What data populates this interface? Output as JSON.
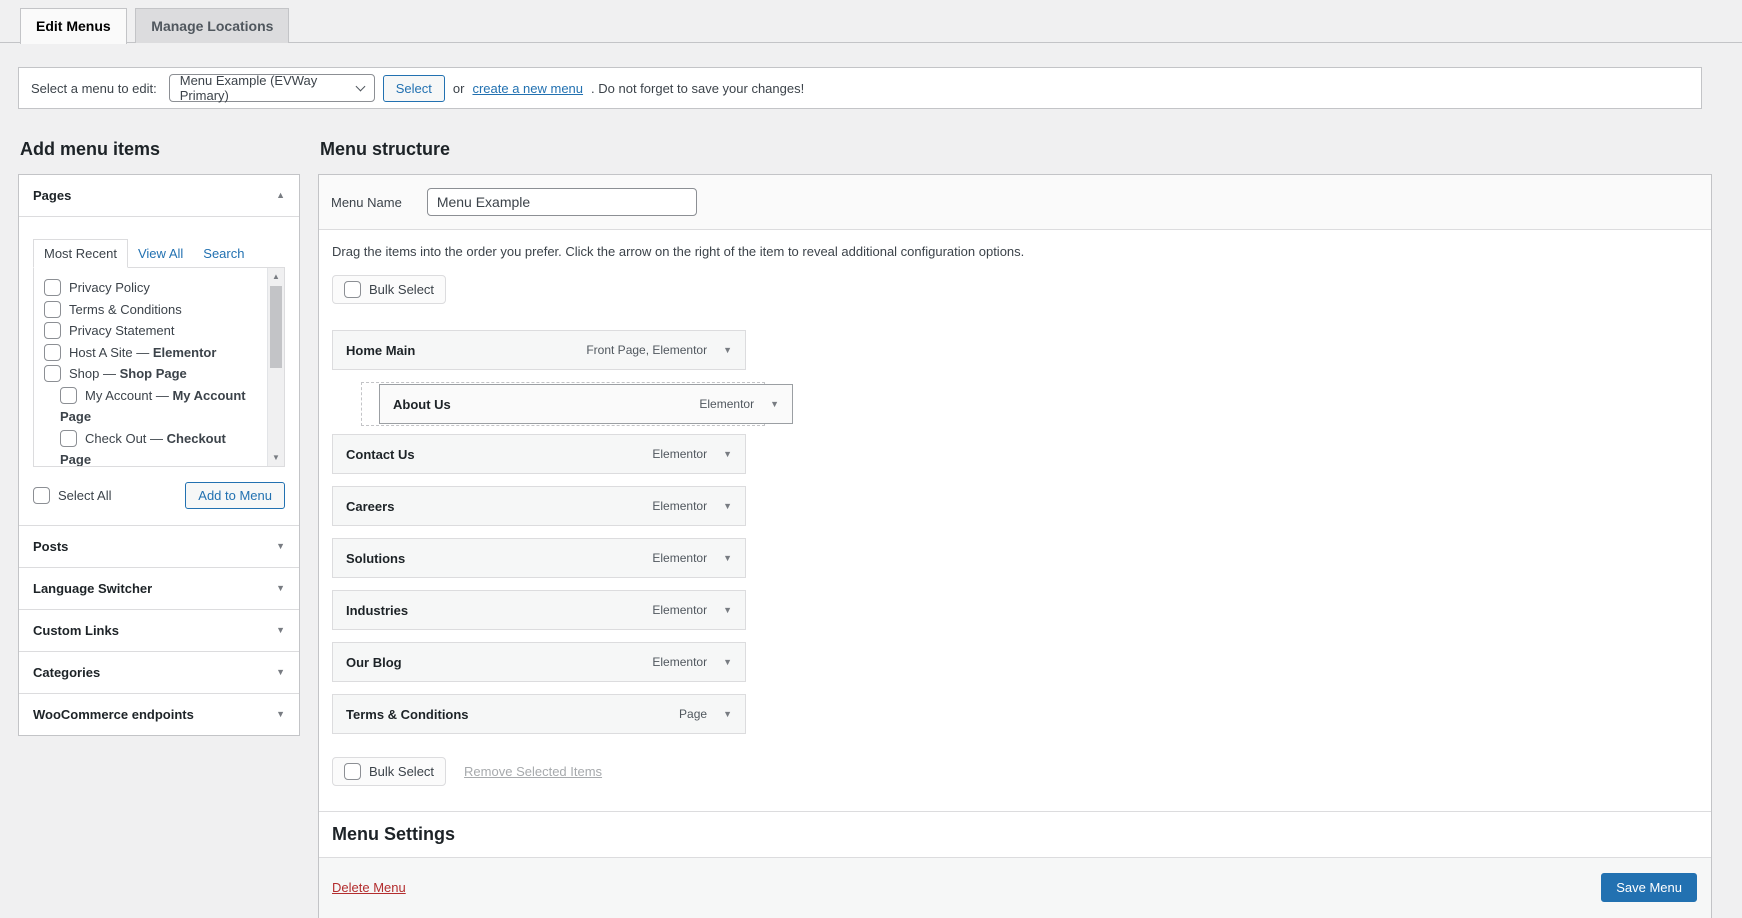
{
  "colors": {
    "accent": "#2271b1",
    "danger": "#b32d2e",
    "background": "#f0f0f1",
    "item_bg": "#f6f7f7"
  },
  "tabs": [
    {
      "label": "Edit Menus",
      "active": true
    },
    {
      "label": "Manage Locations",
      "active": false
    }
  ],
  "menu_select_bar": {
    "label": "Select a menu to edit:",
    "dropdown_value": "Menu Example (EVWay Primary)",
    "select_button": "Select",
    "or_text": "or",
    "create_link": "create a new menu",
    "after_text": ". Do not forget to save your changes!"
  },
  "add_menu_items": {
    "title": "Add menu items",
    "pages_panel": {
      "title": "Pages",
      "tabs": [
        "Most Recent",
        "View All",
        "Search"
      ],
      "active_tab": "Most Recent",
      "items": [
        {
          "label": "Privacy Policy",
          "suffix": "",
          "indent": false
        },
        {
          "label": "Terms & Conditions",
          "suffix": "",
          "indent": false
        },
        {
          "label": "Privacy Statement",
          "suffix": "",
          "indent": false
        },
        {
          "label": "Host A Site",
          "suffix": "Elementor",
          "indent": false
        },
        {
          "label": "Shop",
          "suffix": "Shop Page",
          "indent": false
        },
        {
          "label": "My Account",
          "suffix": "My Account Page",
          "indent": true
        },
        {
          "label": "Check Out",
          "suffix": "Checkout Page",
          "indent": true
        }
      ],
      "select_all_label": "Select All",
      "add_button": "Add to Menu"
    },
    "collapsed_panels": [
      "Posts",
      "Language Switcher",
      "Custom Links",
      "Categories",
      "WooCommerce endpoints"
    ]
  },
  "menu_structure": {
    "title": "Menu structure",
    "name_label": "Menu Name",
    "name_value": "Menu Example",
    "hint": "Drag the items into the order you prefer. Click the arrow on the right of the item to reveal additional configuration options.",
    "bulk_select_label": "Bulk Select",
    "items": [
      {
        "label": "Home Main",
        "type": "Front Page, Elementor",
        "dragging": false
      },
      {
        "label": "About Us",
        "type": "Elementor",
        "dragging": true
      },
      {
        "label": "Contact Us",
        "type": "Elementor",
        "dragging": false
      },
      {
        "label": "Careers",
        "type": "Elementor",
        "dragging": false
      },
      {
        "label": "Solutions",
        "type": "Elementor",
        "dragging": false
      },
      {
        "label": "Industries",
        "type": "Elementor",
        "dragging": false
      },
      {
        "label": "Our Blog",
        "type": "Elementor",
        "dragging": false
      },
      {
        "label": "Terms & Conditions",
        "type": "Page",
        "dragging": false
      }
    ],
    "remove_link": "Remove Selected Items",
    "settings_title": "Menu Settings",
    "delete_link": "Delete Menu",
    "save_button": "Save Menu"
  }
}
